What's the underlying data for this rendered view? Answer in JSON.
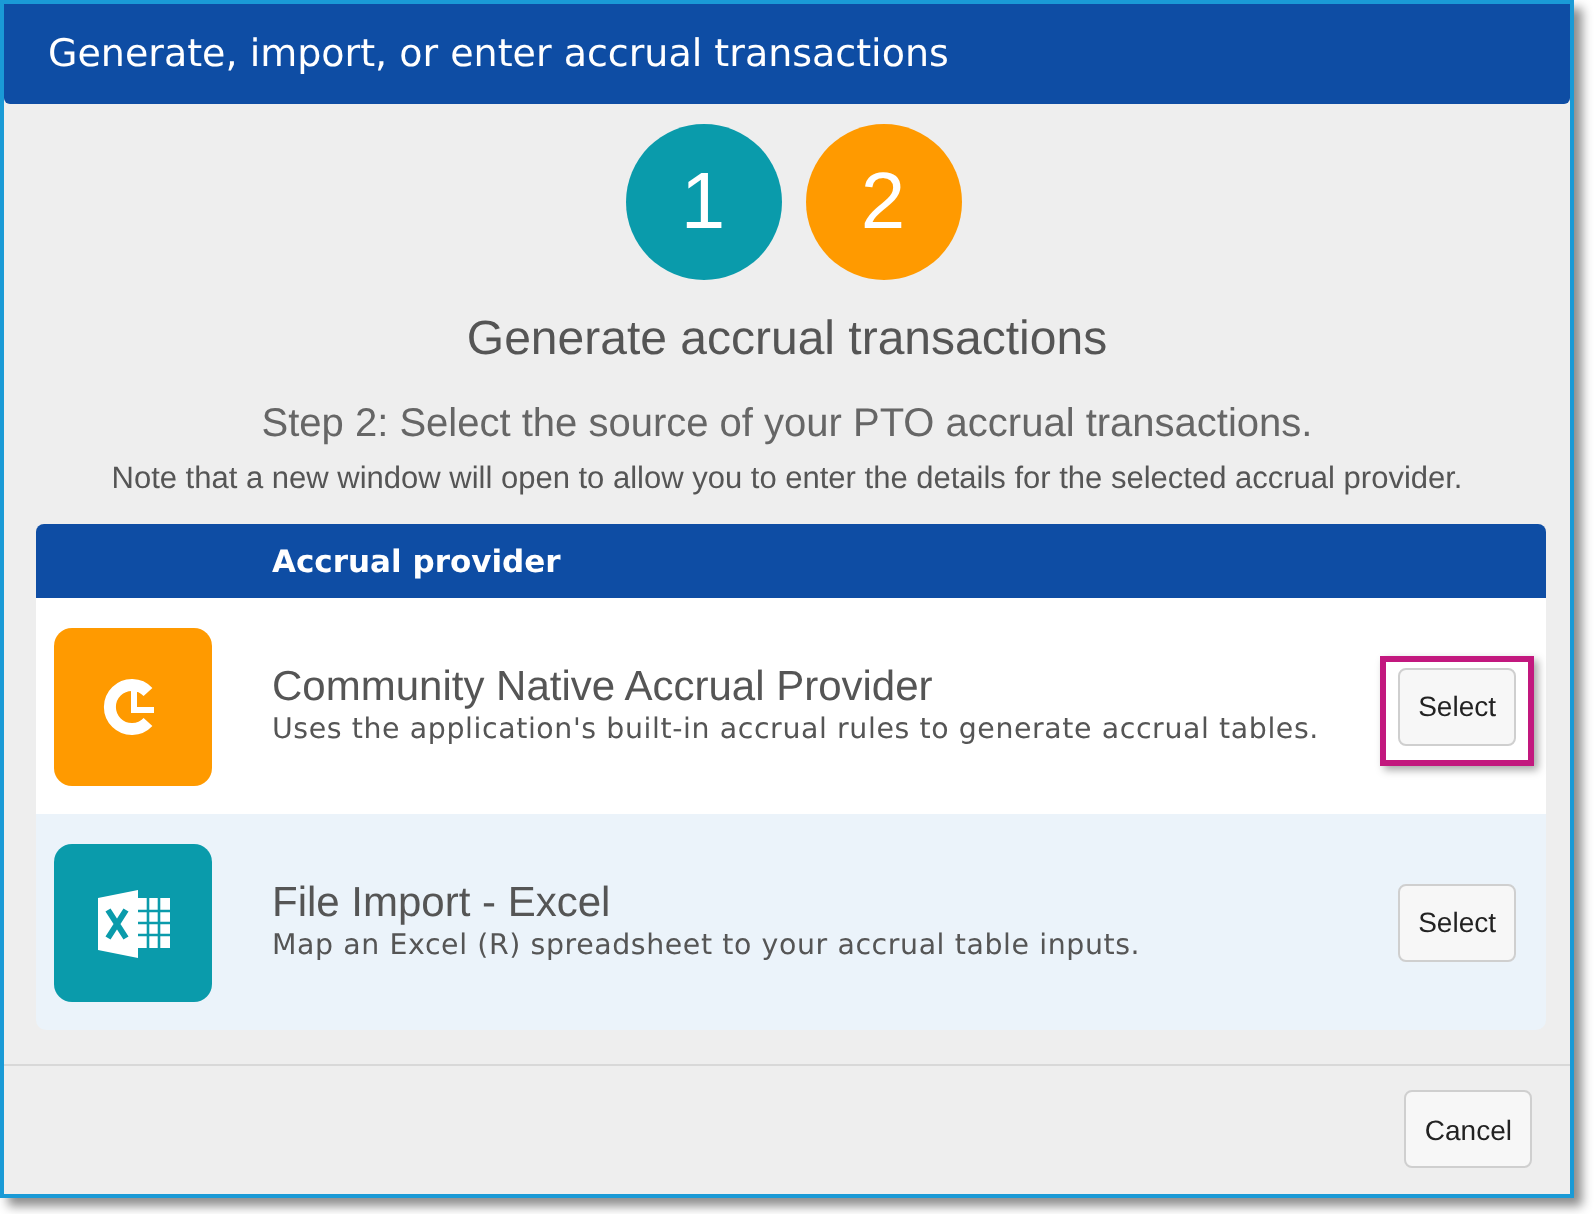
{
  "window": {
    "title": "Generate, import, or enter accrual transactions"
  },
  "steps": [
    {
      "label": "1",
      "color": "#0a9bab"
    },
    {
      "label": "2",
      "color": "#ff9a00"
    }
  ],
  "heading": "Generate accrual transactions",
  "subheading": "Step 2: Select the source of your PTO accrual transactions.",
  "note": "Note that a new window will open to allow you to enter the details for the selected accrual provider.",
  "table": {
    "columns": [
      "Accrual provider"
    ],
    "rows": [
      {
        "kind": "native",
        "color": "#ff9a00",
        "title": "Community Native Accrual Provider",
        "description": "Uses the application's built-in accrual rules to generate accrual tables.",
        "button": "Select",
        "highlighted": true
      },
      {
        "kind": "excel",
        "color": "#0a9bab",
        "title": "File Import - Excel",
        "description": "Map an Excel (R) spreadsheet to your accrual table inputs.",
        "button": "Select",
        "highlighted": false
      }
    ]
  },
  "footer": {
    "buttons": [
      "Cancel"
    ]
  }
}
